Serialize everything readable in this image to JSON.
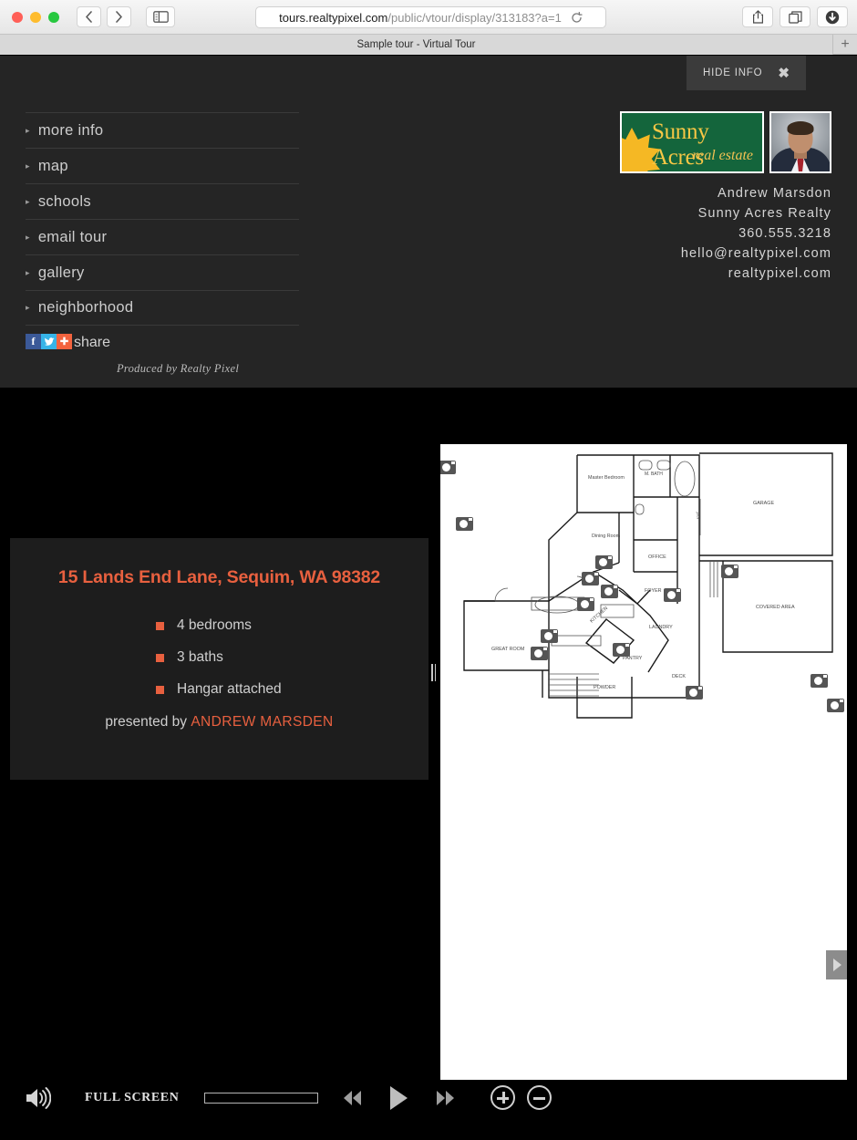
{
  "browser": {
    "traffic_lights": [
      "close",
      "minimize",
      "zoom"
    ],
    "back_label": "‹",
    "forward_label": "›",
    "url_host": "tours.realtypixel.com",
    "url_path": "/public/vtour/display/313183?a=1",
    "reload_label": "↻",
    "tab_title": "Sample tour - Virtual Tour",
    "new_tab_label": "+"
  },
  "info_panel": {
    "hide_info_label": "HIDE INFO",
    "close_label": "✖",
    "menu": [
      {
        "label": "more info"
      },
      {
        "label": "map"
      },
      {
        "label": "schools"
      },
      {
        "label": "email tour"
      },
      {
        "label": "gallery"
      },
      {
        "label": "neighborhood"
      }
    ],
    "caret": "▸",
    "share": {
      "facebook": "f",
      "twitter": "t",
      "addthis": "+",
      "label": "share"
    },
    "produced_by": "Produced by Realty Pixel"
  },
  "agent": {
    "logo_line1": "Sunny Acres",
    "logo_line2": "real estate",
    "name": "Andrew Marsdon",
    "company": "Sunny Acres Realty",
    "phone": "360.555.3218",
    "email": "hello@realtypixel.com",
    "website": "realtypixel.com"
  },
  "property": {
    "address": "15 Lands End Lane, Sequim, WA 98382",
    "features": [
      "4 bedrooms",
      "3 baths",
      "Hangar attached"
    ],
    "presented_prefix": "presented by ",
    "presented_agent": "ANDREW MARSDEN"
  },
  "floorplan": {
    "rooms": [
      "Master Bedroom",
      "M. BATH",
      "GARAGE",
      "Dining Room",
      "OFFICE",
      "FOYER",
      "LAUNDRY",
      "COVERED AREA",
      "GREAT ROOM",
      "KITCHEN",
      "PANTRY",
      "POWDER",
      "DECK"
    ],
    "camera_count": 15
  },
  "controls": {
    "volume_icon": "speaker-icon",
    "fullscreen_label": "FULL SCREEN",
    "rewind_label": "◀◀",
    "play_label": "▶",
    "forward_label": "▶▶",
    "zoom_in_label": "+",
    "zoom_out_label": "−",
    "progress_percent": 0
  },
  "colors": {
    "accent": "#e8603f",
    "panel_bg": "#252525",
    "stage_bg": "#000000",
    "logo_green": "#14653c",
    "logo_gold": "#f5b824"
  }
}
